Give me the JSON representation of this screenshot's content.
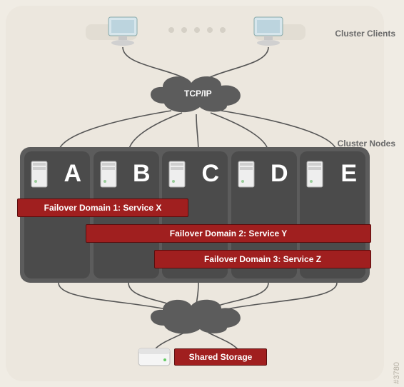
{
  "labels": {
    "cluster_clients": "Cluster Clients",
    "cluster_nodes": "Cluster Nodes",
    "tcpip": "TCP/IP",
    "shared_storage": "Shared Storage",
    "docnum": "#3780"
  },
  "nodes": [
    {
      "letter": "A"
    },
    {
      "letter": "B"
    },
    {
      "letter": "C"
    },
    {
      "letter": "D"
    },
    {
      "letter": "E"
    }
  ],
  "failover": [
    {
      "text": "Failover Domain 1: Service X"
    },
    {
      "text": "Failover Domain 2: Service Y"
    },
    {
      "text": "Failover Domain 3: Service Z"
    }
  ]
}
